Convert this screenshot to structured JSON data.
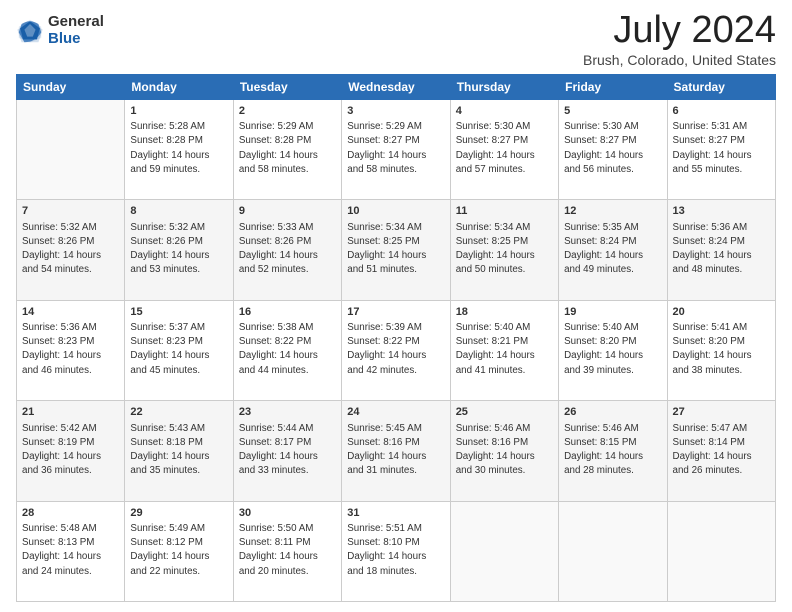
{
  "header": {
    "logo_general": "General",
    "logo_blue": "Blue",
    "title": "July 2024",
    "subtitle": "Brush, Colorado, United States"
  },
  "weekdays": [
    "Sunday",
    "Monday",
    "Tuesday",
    "Wednesday",
    "Thursday",
    "Friday",
    "Saturday"
  ],
  "weeks": [
    [
      {
        "day": "",
        "sunrise": "",
        "sunset": "",
        "daylight": ""
      },
      {
        "day": "1",
        "sunrise": "Sunrise: 5:28 AM",
        "sunset": "Sunset: 8:28 PM",
        "daylight": "Daylight: 14 hours and 59 minutes."
      },
      {
        "day": "2",
        "sunrise": "Sunrise: 5:29 AM",
        "sunset": "Sunset: 8:28 PM",
        "daylight": "Daylight: 14 hours and 58 minutes."
      },
      {
        "day": "3",
        "sunrise": "Sunrise: 5:29 AM",
        "sunset": "Sunset: 8:27 PM",
        "daylight": "Daylight: 14 hours and 58 minutes."
      },
      {
        "day": "4",
        "sunrise": "Sunrise: 5:30 AM",
        "sunset": "Sunset: 8:27 PM",
        "daylight": "Daylight: 14 hours and 57 minutes."
      },
      {
        "day": "5",
        "sunrise": "Sunrise: 5:30 AM",
        "sunset": "Sunset: 8:27 PM",
        "daylight": "Daylight: 14 hours and 56 minutes."
      },
      {
        "day": "6",
        "sunrise": "Sunrise: 5:31 AM",
        "sunset": "Sunset: 8:27 PM",
        "daylight": "Daylight: 14 hours and 55 minutes."
      }
    ],
    [
      {
        "day": "7",
        "sunrise": "Sunrise: 5:32 AM",
        "sunset": "Sunset: 8:26 PM",
        "daylight": "Daylight: 14 hours and 54 minutes."
      },
      {
        "day": "8",
        "sunrise": "Sunrise: 5:32 AM",
        "sunset": "Sunset: 8:26 PM",
        "daylight": "Daylight: 14 hours and 53 minutes."
      },
      {
        "day": "9",
        "sunrise": "Sunrise: 5:33 AM",
        "sunset": "Sunset: 8:26 PM",
        "daylight": "Daylight: 14 hours and 52 minutes."
      },
      {
        "day": "10",
        "sunrise": "Sunrise: 5:34 AM",
        "sunset": "Sunset: 8:25 PM",
        "daylight": "Daylight: 14 hours and 51 minutes."
      },
      {
        "day": "11",
        "sunrise": "Sunrise: 5:34 AM",
        "sunset": "Sunset: 8:25 PM",
        "daylight": "Daylight: 14 hours and 50 minutes."
      },
      {
        "day": "12",
        "sunrise": "Sunrise: 5:35 AM",
        "sunset": "Sunset: 8:24 PM",
        "daylight": "Daylight: 14 hours and 49 minutes."
      },
      {
        "day": "13",
        "sunrise": "Sunrise: 5:36 AM",
        "sunset": "Sunset: 8:24 PM",
        "daylight": "Daylight: 14 hours and 48 minutes."
      }
    ],
    [
      {
        "day": "14",
        "sunrise": "Sunrise: 5:36 AM",
        "sunset": "Sunset: 8:23 PM",
        "daylight": "Daylight: 14 hours and 46 minutes."
      },
      {
        "day": "15",
        "sunrise": "Sunrise: 5:37 AM",
        "sunset": "Sunset: 8:23 PM",
        "daylight": "Daylight: 14 hours and 45 minutes."
      },
      {
        "day": "16",
        "sunrise": "Sunrise: 5:38 AM",
        "sunset": "Sunset: 8:22 PM",
        "daylight": "Daylight: 14 hours and 44 minutes."
      },
      {
        "day": "17",
        "sunrise": "Sunrise: 5:39 AM",
        "sunset": "Sunset: 8:22 PM",
        "daylight": "Daylight: 14 hours and 42 minutes."
      },
      {
        "day": "18",
        "sunrise": "Sunrise: 5:40 AM",
        "sunset": "Sunset: 8:21 PM",
        "daylight": "Daylight: 14 hours and 41 minutes."
      },
      {
        "day": "19",
        "sunrise": "Sunrise: 5:40 AM",
        "sunset": "Sunset: 8:20 PM",
        "daylight": "Daylight: 14 hours and 39 minutes."
      },
      {
        "day": "20",
        "sunrise": "Sunrise: 5:41 AM",
        "sunset": "Sunset: 8:20 PM",
        "daylight": "Daylight: 14 hours and 38 minutes."
      }
    ],
    [
      {
        "day": "21",
        "sunrise": "Sunrise: 5:42 AM",
        "sunset": "Sunset: 8:19 PM",
        "daylight": "Daylight: 14 hours and 36 minutes."
      },
      {
        "day": "22",
        "sunrise": "Sunrise: 5:43 AM",
        "sunset": "Sunset: 8:18 PM",
        "daylight": "Daylight: 14 hours and 35 minutes."
      },
      {
        "day": "23",
        "sunrise": "Sunrise: 5:44 AM",
        "sunset": "Sunset: 8:17 PM",
        "daylight": "Daylight: 14 hours and 33 minutes."
      },
      {
        "day": "24",
        "sunrise": "Sunrise: 5:45 AM",
        "sunset": "Sunset: 8:16 PM",
        "daylight": "Daylight: 14 hours and 31 minutes."
      },
      {
        "day": "25",
        "sunrise": "Sunrise: 5:46 AM",
        "sunset": "Sunset: 8:16 PM",
        "daylight": "Daylight: 14 hours and 30 minutes."
      },
      {
        "day": "26",
        "sunrise": "Sunrise: 5:46 AM",
        "sunset": "Sunset: 8:15 PM",
        "daylight": "Daylight: 14 hours and 28 minutes."
      },
      {
        "day": "27",
        "sunrise": "Sunrise: 5:47 AM",
        "sunset": "Sunset: 8:14 PM",
        "daylight": "Daylight: 14 hours and 26 minutes."
      }
    ],
    [
      {
        "day": "28",
        "sunrise": "Sunrise: 5:48 AM",
        "sunset": "Sunset: 8:13 PM",
        "daylight": "Daylight: 14 hours and 24 minutes."
      },
      {
        "day": "29",
        "sunrise": "Sunrise: 5:49 AM",
        "sunset": "Sunset: 8:12 PM",
        "daylight": "Daylight: 14 hours and 22 minutes."
      },
      {
        "day": "30",
        "sunrise": "Sunrise: 5:50 AM",
        "sunset": "Sunset: 8:11 PM",
        "daylight": "Daylight: 14 hours and 20 minutes."
      },
      {
        "day": "31",
        "sunrise": "Sunrise: 5:51 AM",
        "sunset": "Sunset: 8:10 PM",
        "daylight": "Daylight: 14 hours and 18 minutes."
      },
      {
        "day": "",
        "sunrise": "",
        "sunset": "",
        "daylight": ""
      },
      {
        "day": "",
        "sunrise": "",
        "sunset": "",
        "daylight": ""
      },
      {
        "day": "",
        "sunrise": "",
        "sunset": "",
        "daylight": ""
      }
    ]
  ]
}
